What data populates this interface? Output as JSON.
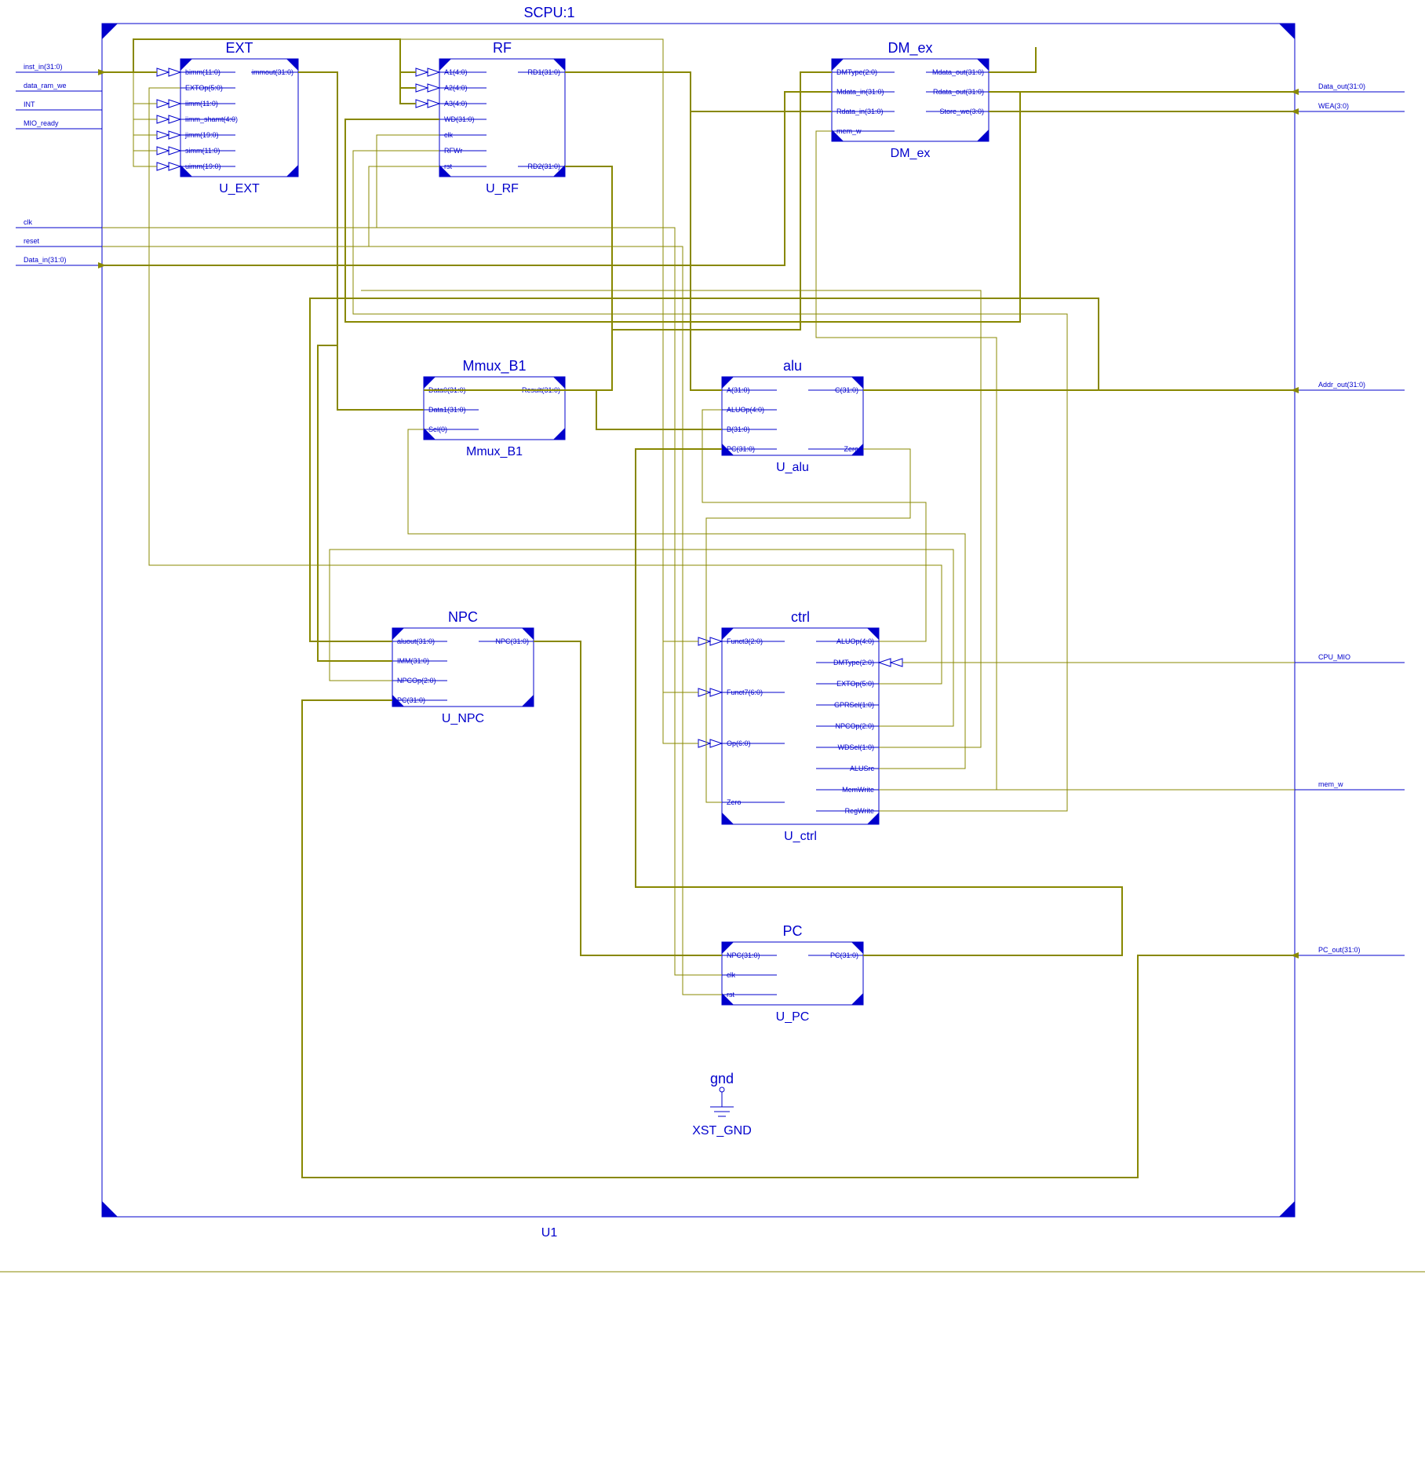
{
  "top": {
    "title": "SCPU:1",
    "instance": "U1"
  },
  "blocks": {
    "ext": {
      "title": "EXT",
      "instance": "U_EXT",
      "left": [
        "bimm(11:0)",
        "EXTOp(5:0)",
        "iimm(11:0)",
        "iimm_shamt(4:0)",
        "jimm(19:0)",
        "simm(11:0)",
        "uimm(19:0)"
      ],
      "right": [
        "immout(31:0)"
      ]
    },
    "rf": {
      "title": "RF",
      "instance": "U_RF",
      "left": [
        "A1(4:0)",
        "A2(4:0)",
        "A3(4:0)",
        "WD(31:0)",
        "clk",
        "RFWr",
        "rst"
      ],
      "right": [
        "RD1(31:0)",
        "RD2(31:0)"
      ]
    },
    "dmex": {
      "title": "DM_ex",
      "instance": "DM_ex",
      "left": [
        "DMType(2:0)",
        "Mdata_in(31:0)",
        "Rdata_in(31:0)",
        "mem_w"
      ],
      "right": [
        "Mdata_out(31:0)",
        "Rdata_out(31:0)",
        "Store_we(3:0)"
      ]
    },
    "mmux": {
      "title": "Mmux_B1",
      "instance": "Mmux_B1",
      "left": [
        "Data0(31:0)",
        "Data1(31:0)",
        "Sel(0)"
      ],
      "right": [
        "Result(31:0)"
      ]
    },
    "alu": {
      "title": "alu",
      "instance": "U_alu",
      "left": [
        "A(31:0)",
        "ALUOp(4:0)",
        "B(31:0)",
        "PC(31:0)"
      ],
      "right": [
        "C(31:0)",
        "Zero"
      ]
    },
    "npc": {
      "title": "NPC",
      "instance": "U_NPC",
      "left": [
        "aluout(31:0)",
        "IMM(31:0)",
        "NPCOp(2:0)",
        "PC(31:0)"
      ],
      "right": [
        "NPC(31:0)"
      ]
    },
    "ctrl": {
      "title": "ctrl",
      "instance": "U_ctrl",
      "left": [
        "Funct3(2:0)",
        "Funct7(6:0)",
        "Op(6:0)",
        "Zero"
      ],
      "right": [
        "ALUOp(4:0)",
        "DMType(2:0)",
        "EXTOp(5:0)",
        "GPRSel(1:0)",
        "NPCOp(2:0)",
        "WDSel(1:0)",
        "ALUSrc",
        "MemWrite",
        "RegWrite"
      ]
    },
    "pc": {
      "title": "PC",
      "instance": "U_PC",
      "left": [
        "NPC(31:0)",
        "clk",
        "rst"
      ],
      "right": [
        "PC(31:0)"
      ]
    },
    "gnd": {
      "title": "gnd",
      "instance": "XST_GND"
    }
  },
  "outer_left": [
    "inst_in(31:0)",
    "data_ram_we",
    "INT",
    "MIO_ready",
    "clk",
    "reset",
    "Data_in(31:0)"
  ],
  "outer_right": [
    "Data_out(31:0)",
    "WEA(3:0)",
    "Addr_out(31:0)",
    "CPU_MIO",
    "mem_w",
    "PC_out(31:0)"
  ]
}
